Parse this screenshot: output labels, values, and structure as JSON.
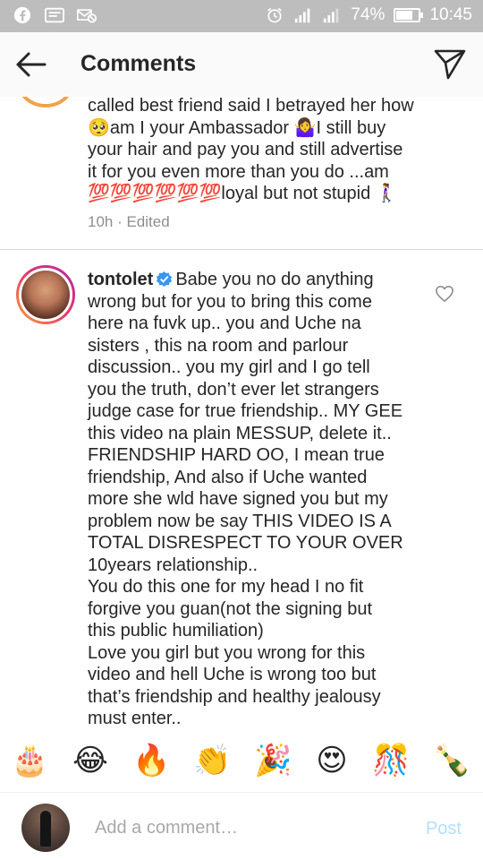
{
  "status_bar": {
    "battery": "74%",
    "battery_level": 0.74,
    "time": "10:45"
  },
  "header": {
    "title": "Comments"
  },
  "previous_comment": {
    "lines": [
      "called best friend said I betrayed her how",
      "🥺am I your Ambassador 🤷‍♀️I still buy",
      "your hair and pay you and still advertise",
      "it for you even more than you do ...am",
      "💯💯💯💯💯💯loyal but not stupid 🚶‍♀️"
    ],
    "meta": "10h · Edited"
  },
  "comment": {
    "username": "tontolet",
    "lines": [
      "Babe you no do anything",
      "wrong but for you to bring this come",
      "here na fuvk up.. you and Uche na",
      "sisters , this na room and parlour",
      "discussion.. you my girl and I go tell",
      "you the truth, don’t ever let strangers",
      "judge case for true friendship.. MY GEE",
      "this video na plain MESSUP, delete it..",
      "FRIENDSHIP HARD OO, I mean true",
      "friendship, And also if Uche wanted",
      "more she wld have signed you but my",
      "problem now be say THIS VIDEO IS A",
      "TOTAL DISRESPECT TO YOUR OVER",
      "10years relationship..",
      "You do this one for my head I no fit",
      "forgive you guan(not the signing but",
      "this public humiliation)",
      "Love you girl but you wrong for this",
      "video and hell Uche is wrong too but",
      "that’s friendship and healthy jealousy",
      "must enter.."
    ]
  },
  "emoji_bar": [
    "🎂",
    "😂",
    "🔥",
    "👏",
    "🎉",
    "😍",
    "🎊",
    "🍾"
  ],
  "composer": {
    "placeholder": "Add a comment…",
    "post_label": "Post"
  },
  "colors": {
    "status_bar_bg": "#bdbdbd",
    "post_disabled": "#b2dffc",
    "verified_blue": "#3897f0",
    "meta_grey": "#8e8e8e"
  },
  "icons": {
    "back": "arrow-left-icon",
    "send": "paper-plane-icon",
    "like": "heart-outline-icon",
    "verified": "verified-badge-icon"
  }
}
